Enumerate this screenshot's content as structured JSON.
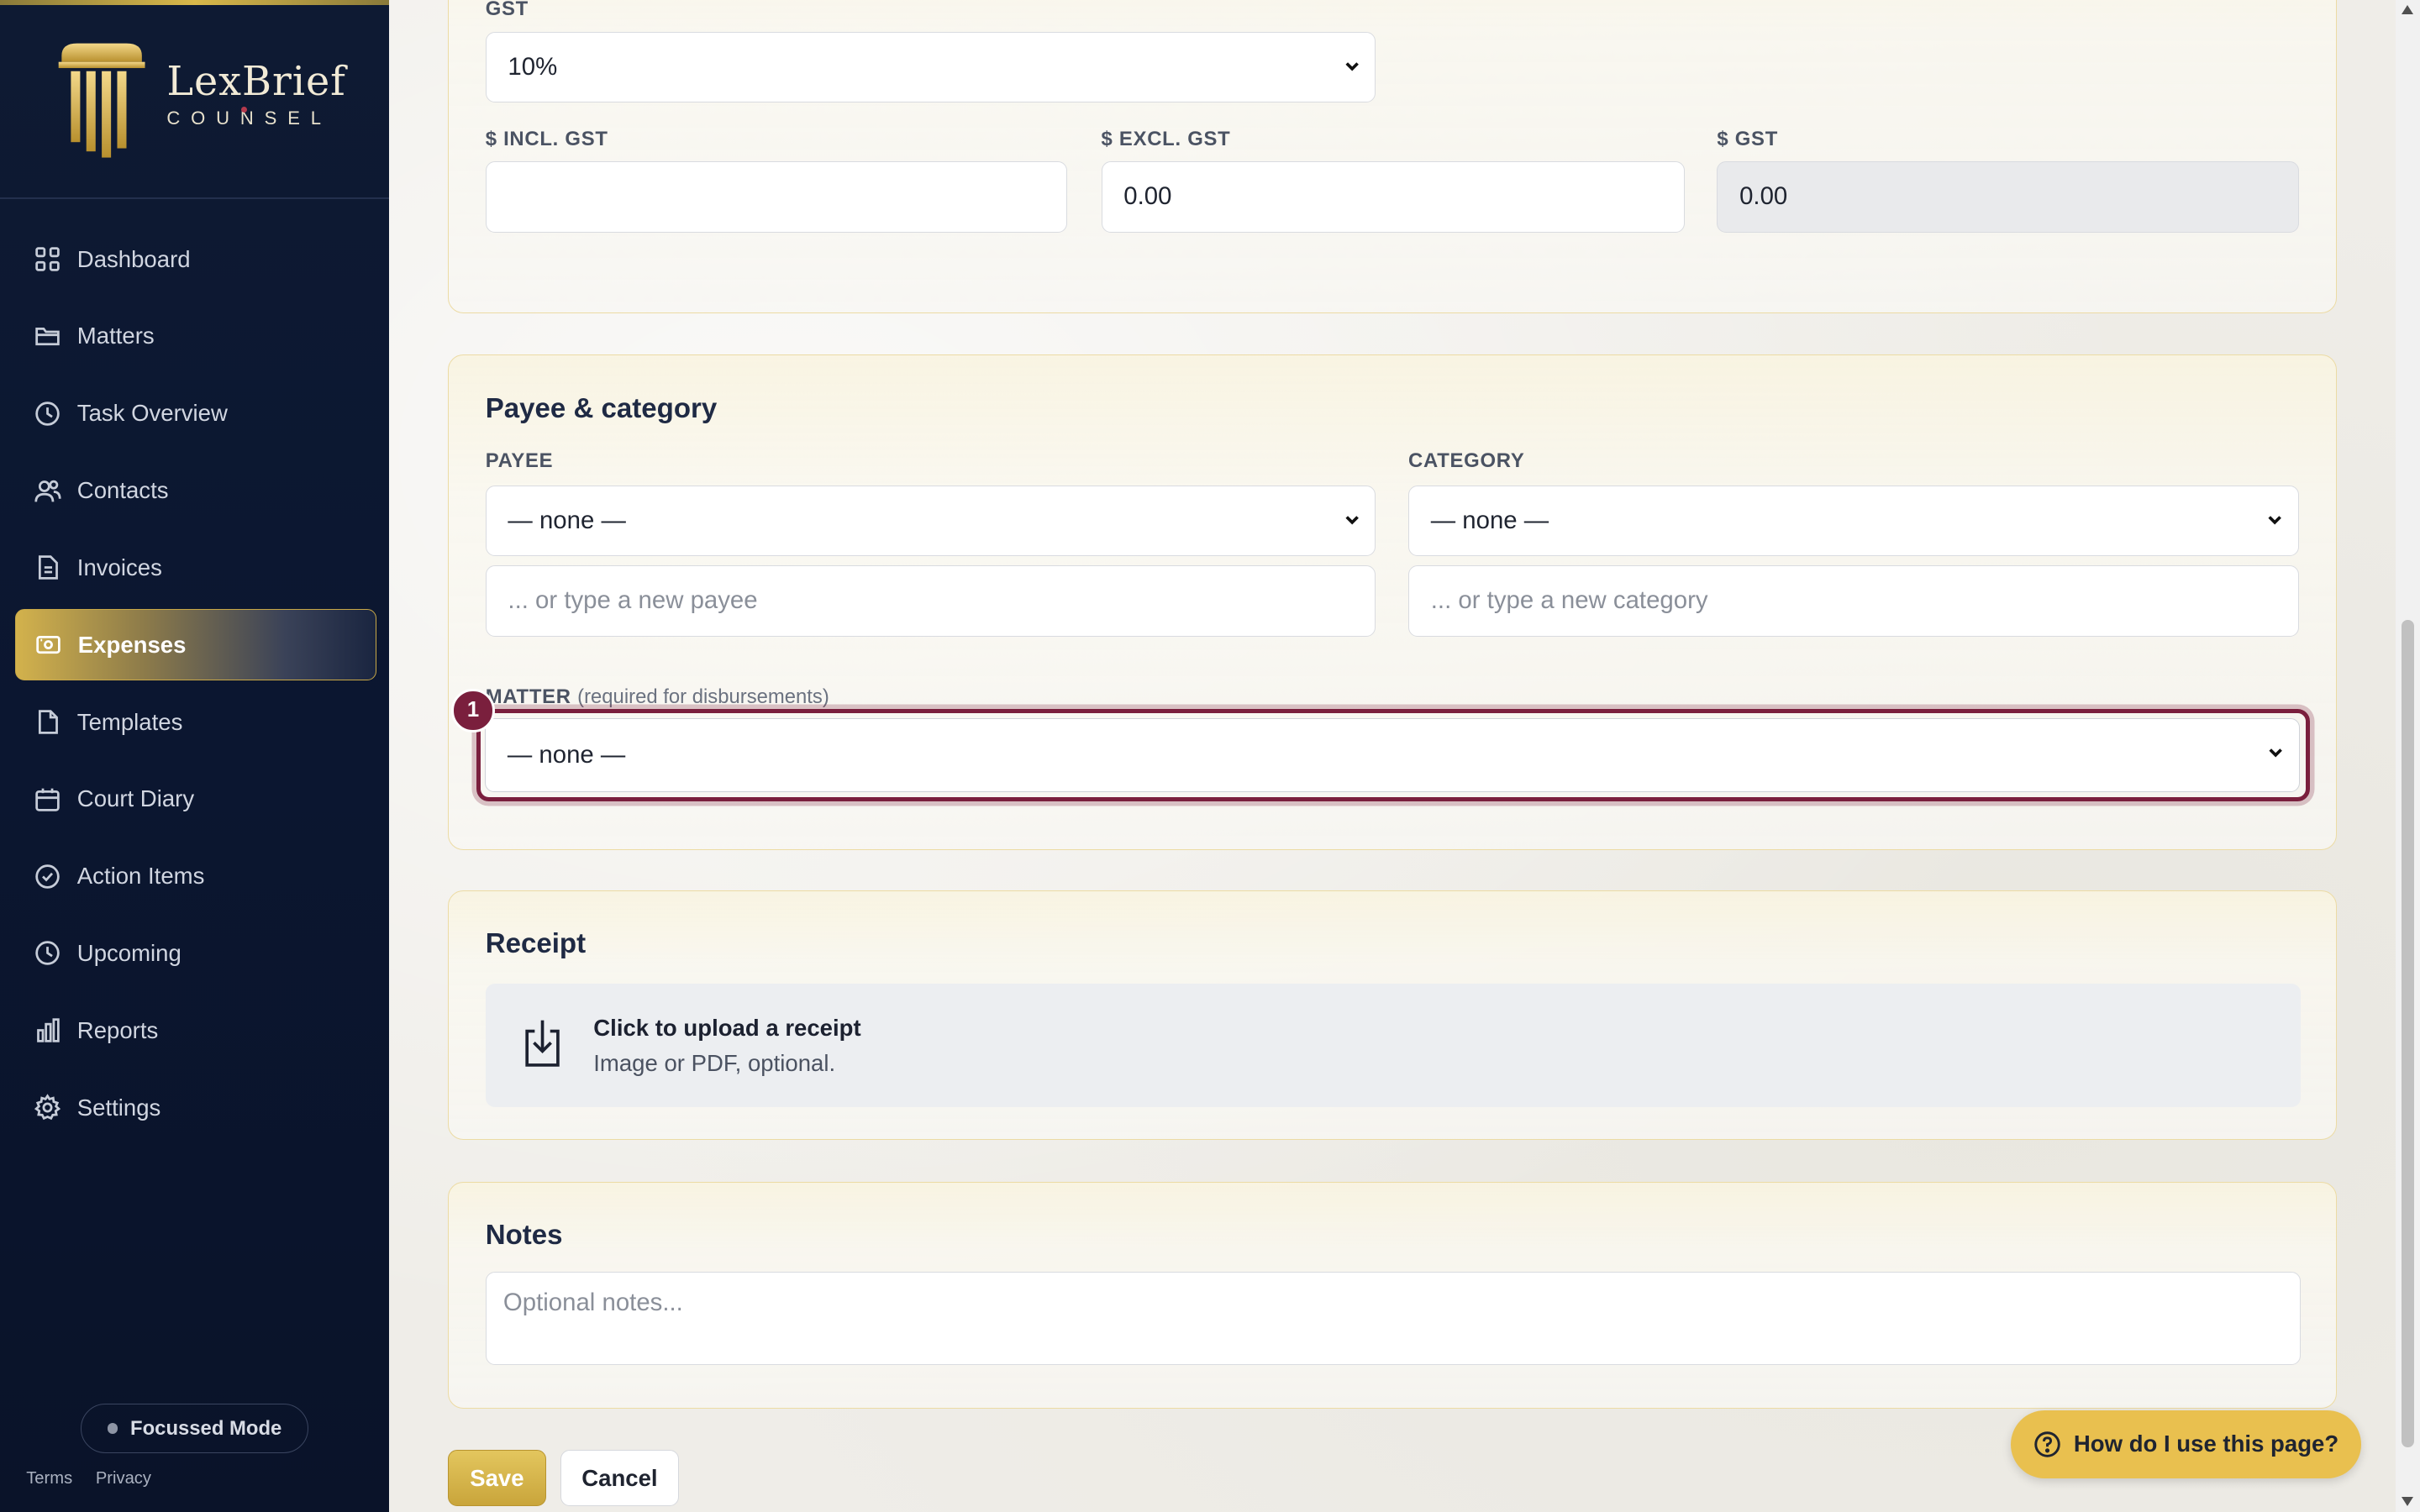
{
  "brand": {
    "name": "LexBrief",
    "sub": "COUNSEL"
  },
  "nav": [
    {
      "label": "Dashboard",
      "icon": "dashboard-icon"
    },
    {
      "label": "Matters",
      "icon": "folder-icon"
    },
    {
      "label": "Task Overview",
      "icon": "clock-icon"
    },
    {
      "label": "Contacts",
      "icon": "users-icon"
    },
    {
      "label": "Invoices",
      "icon": "document-icon"
    },
    {
      "label": "Expenses",
      "icon": "wallet-icon",
      "active": true
    },
    {
      "label": "Templates",
      "icon": "file-icon"
    },
    {
      "label": "Court Diary",
      "icon": "calendar-icon"
    },
    {
      "label": "Action Items",
      "icon": "check-circle-icon"
    },
    {
      "label": "Upcoming",
      "icon": "clock-icon"
    },
    {
      "label": "Reports",
      "icon": "bar-chart-icon"
    },
    {
      "label": "Settings",
      "icon": "gear-icon"
    }
  ],
  "focussed_mode": "Focussed Mode",
  "footer": {
    "terms": "Terms",
    "privacy": "Privacy"
  },
  "amounts": {
    "gst_label": "GST",
    "gst_value": "10%",
    "incl_label": "$ INCL. GST",
    "incl_value": "",
    "excl_label": "$ EXCL. GST",
    "excl_value": "0.00",
    "gst_amt_label": "$ GST",
    "gst_amt_value": "0.00"
  },
  "payee_category": {
    "title": "Payee & category",
    "payee_label": "PAYEE",
    "payee_value": "— none —",
    "payee_new_placeholder": "... or type a new payee",
    "category_label": "CATEGORY",
    "category_value": "— none —",
    "category_new_placeholder": "... or type a new category",
    "matter_label": "MATTER",
    "matter_hint": "(required for disbursements)",
    "matter_value": "— none —",
    "matter_badge": "1"
  },
  "receipt": {
    "title": "Receipt",
    "upload_title": "Click to upload a receipt",
    "upload_sub": "Image or PDF, optional."
  },
  "notes": {
    "title": "Notes",
    "placeholder": "Optional notes..."
  },
  "actions": {
    "save": "Save",
    "cancel": "Cancel"
  },
  "help": "How do I use this page?",
  "colors": {
    "navy": "#0e1a33",
    "gold": "#d8b84a",
    "accent": "#7a1f3d"
  }
}
